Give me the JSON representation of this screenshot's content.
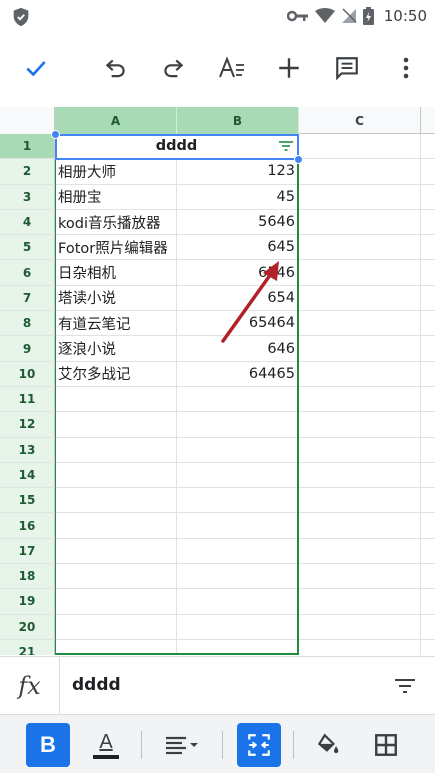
{
  "status_bar": {
    "time": "10:50"
  },
  "toolbar": {
    "done_icon": "check-icon",
    "undo_icon": "undo-icon",
    "redo_icon": "redo-icon",
    "text_format_icon": "text-format-icon",
    "insert_icon": "plus-icon",
    "comment_icon": "comment-icon",
    "more_icon": "more-vert-icon"
  },
  "columns": [
    "A",
    "B",
    "C"
  ],
  "rows": [
    {
      "num": "1",
      "a": "dddd",
      "b": ""
    },
    {
      "num": "2",
      "a": "相册大师",
      "b": "123"
    },
    {
      "num": "3",
      "a": "相册宝",
      "b": "45"
    },
    {
      "num": "4",
      "a": "kodi音乐播放器",
      "b": "5646"
    },
    {
      "num": "5",
      "a": "Fotor照片编辑器",
      "b": "645"
    },
    {
      "num": "6",
      "a": "日杂相机",
      "b": "6546"
    },
    {
      "num": "7",
      "a": "塔读小说",
      "b": "654"
    },
    {
      "num": "8",
      "a": "有道云笔记",
      "b": "65464"
    },
    {
      "num": "9",
      "a": "逐浪小说",
      "b": "646"
    },
    {
      "num": "10",
      "a": "艾尔多战记",
      "b": "64465"
    },
    {
      "num": "11",
      "a": "",
      "b": ""
    },
    {
      "num": "12",
      "a": "",
      "b": ""
    },
    {
      "num": "13",
      "a": "",
      "b": ""
    },
    {
      "num": "14",
      "a": "",
      "b": ""
    },
    {
      "num": "15",
      "a": "",
      "b": ""
    },
    {
      "num": "16",
      "a": "",
      "b": ""
    },
    {
      "num": "17",
      "a": "",
      "b": ""
    },
    {
      "num": "18",
      "a": "",
      "b": ""
    },
    {
      "num": "19",
      "a": "",
      "b": ""
    },
    {
      "num": "20",
      "a": "",
      "b": ""
    },
    {
      "num": "21",
      "a": "",
      "b": ""
    }
  ],
  "formula_bar": {
    "fx_label": "fx",
    "value": "dddd"
  },
  "format_bar": {
    "bold_label": "B",
    "text_color_label": "A"
  },
  "colors": {
    "accent": "#1a73e8",
    "selection_green": "#1e8e3e",
    "header_selected": "#a8dab5",
    "annotation_arrow": "#b3202a"
  }
}
